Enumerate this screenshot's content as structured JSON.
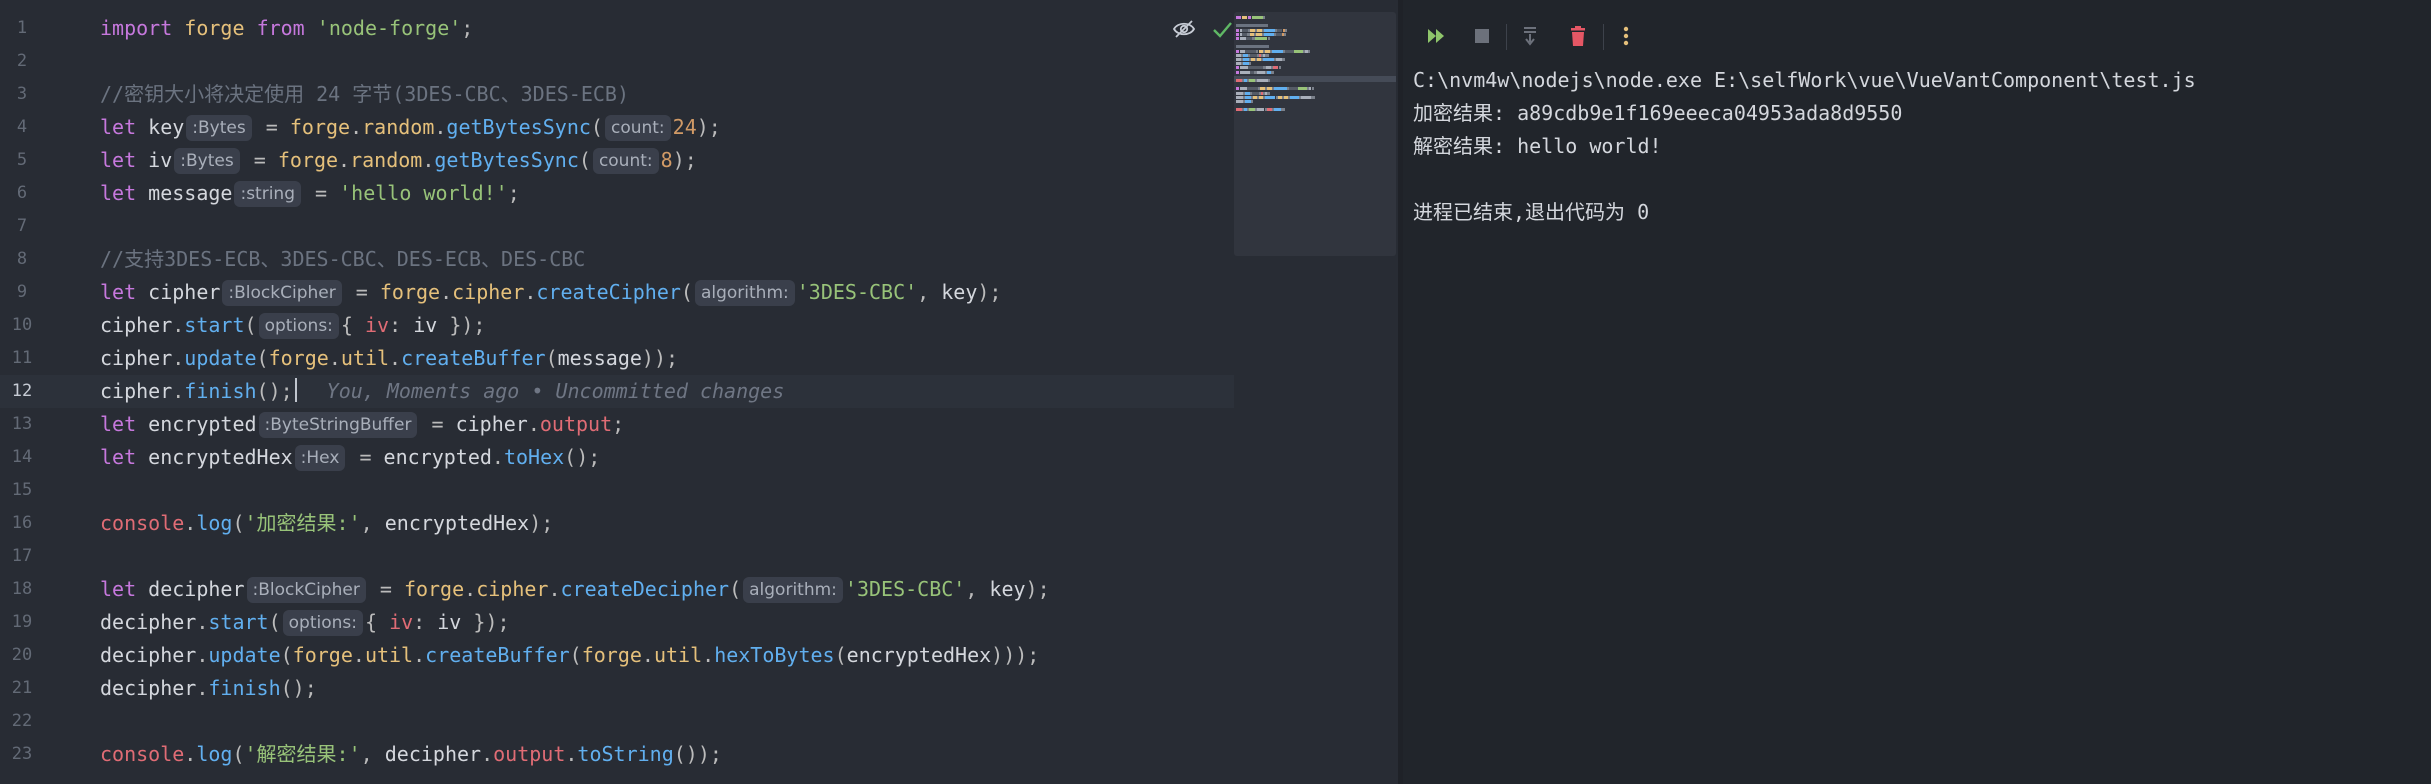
{
  "editor": {
    "blame": "You, Moments ago • Uncommitted changes",
    "lines": [
      {
        "n": "1",
        "tokens": [
          [
            "kw",
            "import"
          ],
          [
            "pun",
            " "
          ],
          [
            "obj",
            "forge"
          ],
          [
            "pun",
            " "
          ],
          [
            "kw",
            "from"
          ],
          [
            "pun",
            " "
          ],
          [
            "str",
            "'node-forge'"
          ],
          [
            "pun",
            ";"
          ]
        ]
      },
      {
        "n": "2",
        "tokens": []
      },
      {
        "n": "3",
        "tokens": [
          [
            "com",
            "//密钥大小将决定使用 24 字节(3DES-CBC、3DES-ECB)"
          ]
        ]
      },
      {
        "n": "4",
        "tokens": [
          [
            "kw",
            "let"
          ],
          [
            "pun",
            " "
          ],
          [
            "id",
            "key"
          ],
          [
            "hint",
            ":Bytes"
          ],
          [
            "pun",
            " = "
          ],
          [
            "obj",
            "forge"
          ],
          [
            "pun",
            "."
          ],
          [
            "obj",
            "random"
          ],
          [
            "pun",
            "."
          ],
          [
            "fn",
            "getBytesSync"
          ],
          [
            "pun",
            "("
          ],
          [
            "hint",
            "count:"
          ],
          [
            "num",
            "24"
          ],
          [
            "pun",
            ");"
          ]
        ]
      },
      {
        "n": "5",
        "tokens": [
          [
            "kw",
            "let"
          ],
          [
            "pun",
            " "
          ],
          [
            "id",
            "iv"
          ],
          [
            "hint",
            ":Bytes"
          ],
          [
            "pun",
            " = "
          ],
          [
            "obj",
            "forge"
          ],
          [
            "pun",
            "."
          ],
          [
            "obj",
            "random"
          ],
          [
            "pun",
            "."
          ],
          [
            "fn",
            "getBytesSync"
          ],
          [
            "pun",
            "("
          ],
          [
            "hint",
            "count:"
          ],
          [
            "num",
            "8"
          ],
          [
            "pun",
            ");"
          ]
        ]
      },
      {
        "n": "6",
        "tokens": [
          [
            "kw",
            "let"
          ],
          [
            "pun",
            " "
          ],
          [
            "id",
            "message"
          ],
          [
            "hint",
            ":string"
          ],
          [
            "pun",
            " = "
          ],
          [
            "str",
            "'hello world!'"
          ],
          [
            "pun",
            ";"
          ]
        ]
      },
      {
        "n": "7",
        "tokens": []
      },
      {
        "n": "8",
        "tokens": [
          [
            "com",
            "//支持3DES-ECB、3DES-CBC、DES-ECB、DES-CBC"
          ]
        ]
      },
      {
        "n": "9",
        "tokens": [
          [
            "kw",
            "let"
          ],
          [
            "pun",
            " "
          ],
          [
            "id",
            "cipher"
          ],
          [
            "hint",
            ":BlockCipher"
          ],
          [
            "pun",
            " = "
          ],
          [
            "obj",
            "forge"
          ],
          [
            "pun",
            "."
          ],
          [
            "obj",
            "cipher"
          ],
          [
            "pun",
            "."
          ],
          [
            "fn",
            "createCipher"
          ],
          [
            "pun",
            "("
          ],
          [
            "hint",
            "algorithm:"
          ],
          [
            "str",
            "'3DES-CBC'"
          ],
          [
            "pun",
            ", "
          ],
          [
            "id",
            "key"
          ],
          [
            "pun",
            ");"
          ]
        ]
      },
      {
        "n": "10",
        "tokens": [
          [
            "id",
            "cipher"
          ],
          [
            "pun",
            "."
          ],
          [
            "fn",
            "start"
          ],
          [
            "pun",
            "("
          ],
          [
            "hint",
            "options:"
          ],
          [
            "pun",
            "{ "
          ],
          [
            "prop",
            "iv"
          ],
          [
            "pun",
            ": "
          ],
          [
            "id",
            "iv"
          ],
          [
            "pun",
            " });"
          ]
        ]
      },
      {
        "n": "11",
        "tokens": [
          [
            "id",
            "cipher"
          ],
          [
            "pun",
            "."
          ],
          [
            "fn",
            "update"
          ],
          [
            "pun",
            "("
          ],
          [
            "obj",
            "forge"
          ],
          [
            "pun",
            "."
          ],
          [
            "obj",
            "util"
          ],
          [
            "pun",
            "."
          ],
          [
            "fn",
            "createBuffer"
          ],
          [
            "pun",
            "("
          ],
          [
            "id",
            "message"
          ],
          [
            "pun",
            "));"
          ]
        ]
      },
      {
        "n": "12",
        "current": true,
        "tokens": [
          [
            "id",
            "cipher"
          ],
          [
            "pun",
            "."
          ],
          [
            "fn",
            "finish"
          ],
          [
            "pun",
            "();"
          ],
          [
            "caret",
            ""
          ],
          [
            "blame",
            ""
          ]
        ]
      },
      {
        "n": "13",
        "tokens": [
          [
            "kw",
            "let"
          ],
          [
            "pun",
            " "
          ],
          [
            "id",
            "encrypted"
          ],
          [
            "hint",
            ":ByteStringBuffer"
          ],
          [
            "pun",
            " = "
          ],
          [
            "id",
            "cipher"
          ],
          [
            "pun",
            "."
          ],
          [
            "prop",
            "output"
          ],
          [
            "pun",
            ";"
          ]
        ]
      },
      {
        "n": "14",
        "tokens": [
          [
            "kw",
            "let"
          ],
          [
            "pun",
            " "
          ],
          [
            "id",
            "encryptedHex"
          ],
          [
            "hint",
            ":Hex"
          ],
          [
            "pun",
            " = "
          ],
          [
            "id",
            "encrypted"
          ],
          [
            "pun",
            "."
          ],
          [
            "fn",
            "toHex"
          ],
          [
            "pun",
            "();"
          ]
        ]
      },
      {
        "n": "15",
        "tokens": []
      },
      {
        "n": "16",
        "tokens": [
          [
            "prop",
            "console"
          ],
          [
            "pun",
            "."
          ],
          [
            "fn",
            "log"
          ],
          [
            "pun",
            "("
          ],
          [
            "str",
            "'加密结果:'"
          ],
          [
            "pun",
            ", "
          ],
          [
            "id",
            "encryptedHex"
          ],
          [
            "pun",
            ");"
          ]
        ]
      },
      {
        "n": "17",
        "tokens": []
      },
      {
        "n": "18",
        "tokens": [
          [
            "kw",
            "let"
          ],
          [
            "pun",
            " "
          ],
          [
            "id",
            "decipher"
          ],
          [
            "hint",
            ":BlockCipher"
          ],
          [
            "pun",
            " = "
          ],
          [
            "obj",
            "forge"
          ],
          [
            "pun",
            "."
          ],
          [
            "obj",
            "cipher"
          ],
          [
            "pun",
            "."
          ],
          [
            "fn",
            "createDecipher"
          ],
          [
            "pun",
            "("
          ],
          [
            "hint",
            "algorithm:"
          ],
          [
            "str",
            "'3DES-CBC'"
          ],
          [
            "pun",
            ", "
          ],
          [
            "id",
            "key"
          ],
          [
            "pun",
            ");"
          ]
        ]
      },
      {
        "n": "19",
        "tokens": [
          [
            "id",
            "decipher"
          ],
          [
            "pun",
            "."
          ],
          [
            "fn",
            "start"
          ],
          [
            "pun",
            "("
          ],
          [
            "hint",
            "options:"
          ],
          [
            "pun",
            "{ "
          ],
          [
            "prop",
            "iv"
          ],
          [
            "pun",
            ": "
          ],
          [
            "id",
            "iv"
          ],
          [
            "pun",
            " });"
          ]
        ]
      },
      {
        "n": "20",
        "tokens": [
          [
            "id",
            "decipher"
          ],
          [
            "pun",
            "."
          ],
          [
            "fn",
            "update"
          ],
          [
            "pun",
            "("
          ],
          [
            "obj",
            "forge"
          ],
          [
            "pun",
            "."
          ],
          [
            "obj",
            "util"
          ],
          [
            "pun",
            "."
          ],
          [
            "fn",
            "createBuffer"
          ],
          [
            "pun",
            "("
          ],
          [
            "obj",
            "forge"
          ],
          [
            "pun",
            "."
          ],
          [
            "obj",
            "util"
          ],
          [
            "pun",
            "."
          ],
          [
            "fn",
            "hexToBytes"
          ],
          [
            "pun",
            "("
          ],
          [
            "id",
            "encryptedHex"
          ],
          [
            "pun",
            ")));"
          ]
        ]
      },
      {
        "n": "21",
        "tokens": [
          [
            "id",
            "decipher"
          ],
          [
            "pun",
            "."
          ],
          [
            "fn",
            "finish"
          ],
          [
            "pun",
            "();"
          ]
        ]
      },
      {
        "n": "22",
        "tokens": []
      },
      {
        "n": "23",
        "tokens": [
          [
            "prop",
            "console"
          ],
          [
            "pun",
            "."
          ],
          [
            "fn",
            "log"
          ],
          [
            "pun",
            "("
          ],
          [
            "str",
            "'解密结果:'"
          ],
          [
            "pun",
            ", "
          ],
          [
            "id",
            "decipher"
          ],
          [
            "pun",
            "."
          ],
          [
            "prop",
            "output"
          ],
          [
            "pun",
            "."
          ],
          [
            "fn",
            "toString"
          ],
          [
            "pun",
            "());"
          ]
        ]
      }
    ]
  },
  "run": {
    "toolbar": [
      {
        "name": "rerun-button",
        "icon": "double-play-icon",
        "color": "#8fc66b"
      },
      {
        "name": "stop-button",
        "icon": "stop-icon",
        "color": "#6c717b"
      },
      {
        "name": "scroll-to-end-button",
        "icon": "scroll-down-icon",
        "color": "#6c717b"
      },
      {
        "name": "clear-button",
        "icon": "trash-icon",
        "color": "#e55765"
      },
      {
        "name": "more-button",
        "icon": "more-vertical-icon",
        "color": "#e5c07b"
      }
    ],
    "output": [
      "C:\\nvm4w\\nodejs\\node.exe E:\\selfWork\\vue\\VueVantComponent\\test.js",
      "加密结果: a89cdb9e1f169eeeca04953ada8d9550",
      "解密结果: hello world!",
      "",
      "进程已结束,退出代码为 0"
    ]
  }
}
